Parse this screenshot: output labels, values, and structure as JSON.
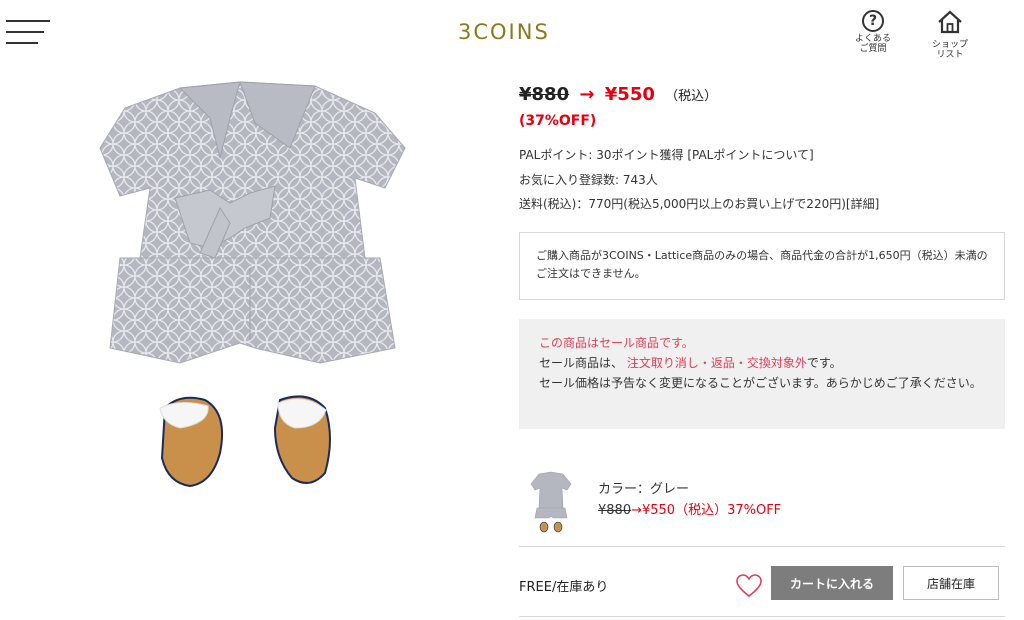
{
  "header": {
    "logo": "3COINS",
    "faq_label": "よくある\nご質問",
    "faq_icon": "question-circle-icon",
    "shop_label": "ショップ\nリスト",
    "shop_icon": "home-icon"
  },
  "price": {
    "old": "¥880",
    "arrow": "→",
    "new": "¥550",
    "tax": "（税込）",
    "discount": "(37%OFF)"
  },
  "info": {
    "points": "PALポイント: 30ポイント獲得 ",
    "points_link": "[PALポイントについて]",
    "favorites": "お気に入り登録数: 743人",
    "shipping": "送料(税込)：770円(税込5,000円以上のお買い上げで220円)",
    "shipping_link": "[詳細]"
  },
  "notice": "ご購入商品が3COINS・Lattice商品のみの場合、商品代金の合計が1,650円（税込）未満のご注文はできません。",
  "sale": {
    "line1": "この商品はセール商品です。",
    "line2_prefix": "セール商品は、",
    "line2_red": "注文取り消し・返品・交換対象外",
    "line2_suffix": "です。",
    "line3": "セール価格は予告なく変更になることがございます。あらかじめご了承ください。"
  },
  "variant": {
    "color": "カラー：グレー",
    "price_old": "¥880",
    "price_rest": "→¥550（税込）37%OFF"
  },
  "purchase": {
    "stock": "FREE/在庫あり",
    "cart_button": "カートに入れる",
    "store_button": "店舗在庫"
  },
  "colors": {
    "accent_red": "#e60012",
    "sale_pink": "#e0405a",
    "logo_olive": "#8a7a1c",
    "cart_gray": "#7d7d7d"
  }
}
